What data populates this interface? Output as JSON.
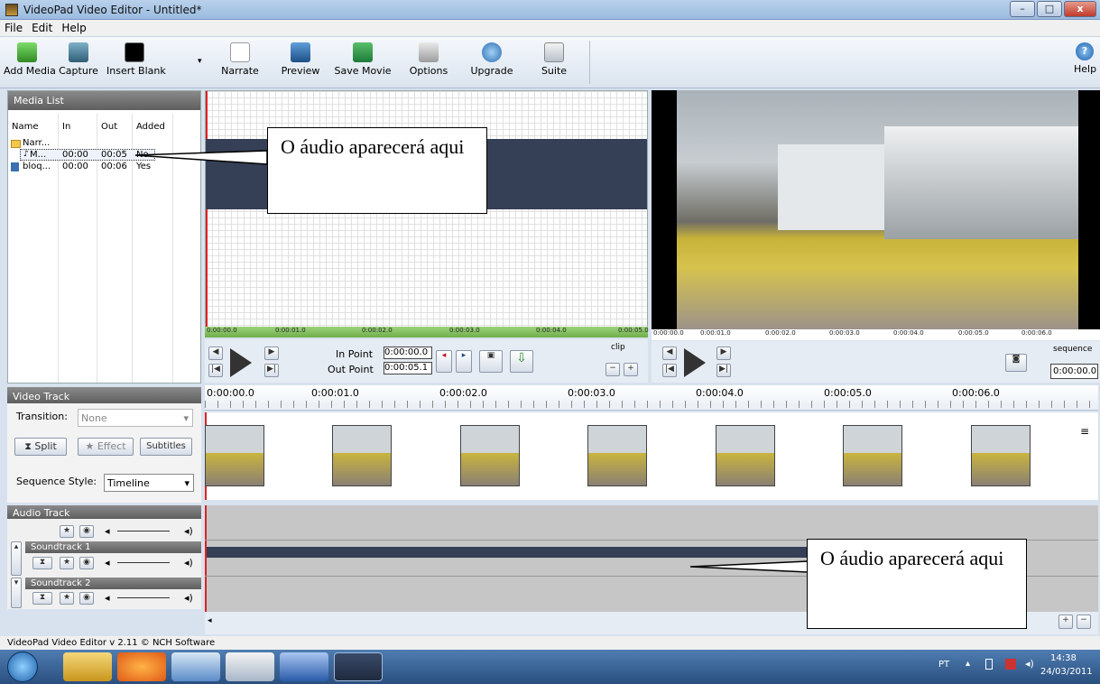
{
  "window": {
    "title": "VideoPad Video Editor - Untitled*",
    "minimize": "–",
    "maximize": "□",
    "close": "x"
  },
  "menu": [
    "File",
    "Edit",
    "Help"
  ],
  "toolbar": {
    "add_media": "Add Media",
    "capture": "Capture",
    "insert_blank": "Insert Blank",
    "narrate": "Narrate",
    "preview": "Preview",
    "save_movie": "Save Movie",
    "options": "Options",
    "upgrade": "Upgrade",
    "suite": "Suite",
    "help": "Help"
  },
  "media_list": {
    "title": "Media List",
    "columns": {
      "name": "Name",
      "in": "In",
      "out": "Out",
      "added": "Added"
    },
    "rows": [
      {
        "name": "Narr...",
        "in": "",
        "out": "",
        "added": ""
      },
      {
        "name": "M...",
        "in": "00:00",
        "out": "00:05",
        "added": "No"
      },
      {
        "name": "bloq...",
        "in": "00:00",
        "out": "00:06",
        "added": "Yes"
      }
    ]
  },
  "clip_preview": {
    "ticks": [
      "0:00:00.0",
      "0:00:01.0",
      "0:00:02.0",
      "0:00:03.0",
      "0:00:04.0",
      "0:00:05.0"
    ],
    "in_point_label": "In Point",
    "in_point_value": "0:00:00.0",
    "out_point_label": "Out Point",
    "out_point_value": "0:00:05.1",
    "tab": "clip"
  },
  "sequence_preview": {
    "ticks": [
      "0:00:00.0",
      "0:00:01.0",
      "0:00:02.0",
      "0:00:03.0",
      "0:00:04.0",
      "0:00:05.0",
      "0:00:06.0"
    ],
    "tab": "sequence",
    "time": "0:00:00.0"
  },
  "timeline": {
    "ticks": [
      "0:00:00.0",
      "0:00:01.0",
      "0:00:02.0",
      "0:00:03.0",
      "0:00:04.0",
      "0:00:05.0",
      "0:00:06.0"
    ]
  },
  "video_track": {
    "title": "Video Track",
    "transition_label": "Transition:",
    "transition_value": "None",
    "split": "Split",
    "effect": "Effect",
    "subtitles": "Subtitles",
    "sequence_style_label": "Sequence Style:",
    "sequence_style_value": "Timeline"
  },
  "audio_track": {
    "title": "Audio Track",
    "soundtrack1": "Soundtrack 1",
    "soundtrack2": "Soundtrack 2"
  },
  "callouts": {
    "top": "O áudio aparecerá aqui",
    "bottom": "O áudio aparecerá aqui"
  },
  "status": "VideoPad Video Editor v 2.11 © NCH Software",
  "taskbar": {
    "lang": "PT",
    "time": "14:38",
    "date": "24/03/2011"
  }
}
